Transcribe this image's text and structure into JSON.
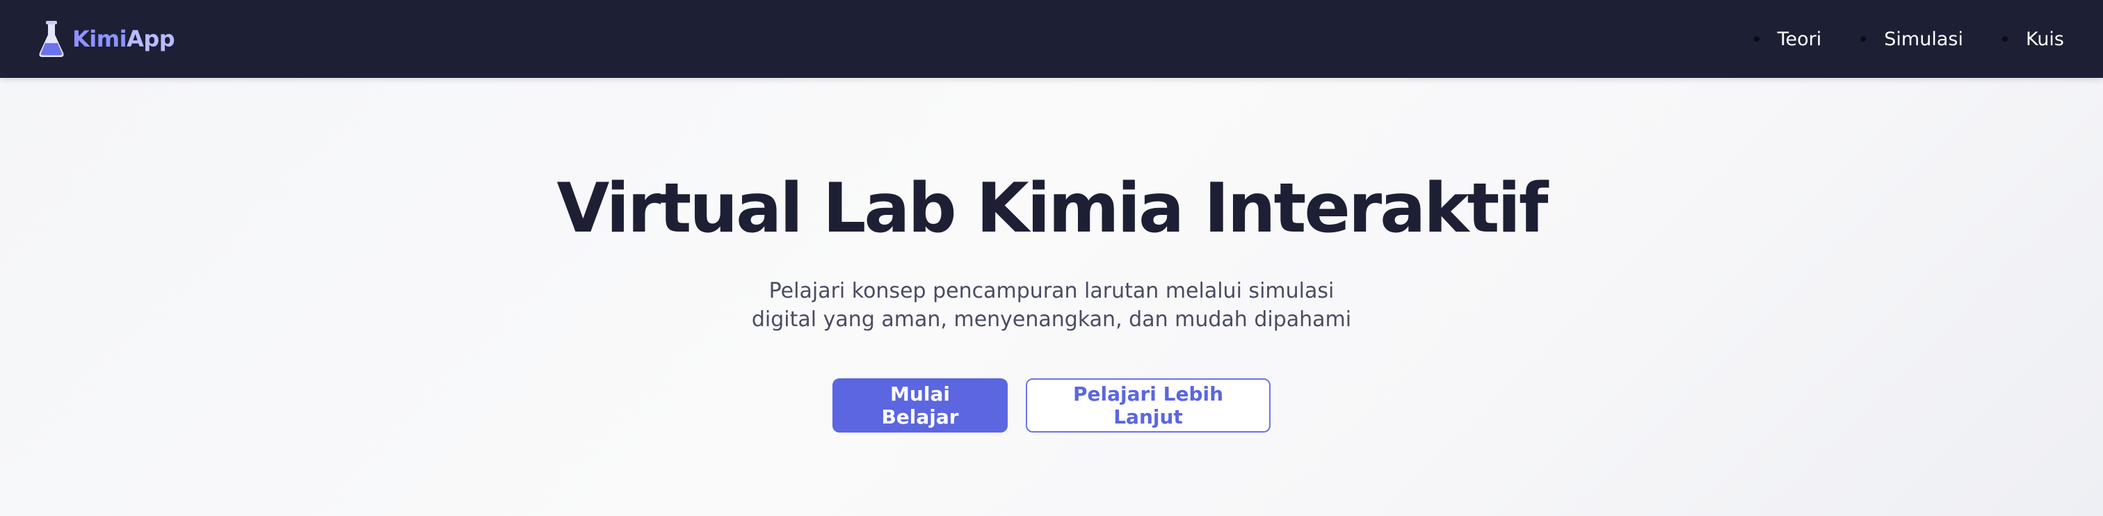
{
  "brand": {
    "name_part1": "Kimi",
    "name_part2": "App",
    "icon": "flask-icon"
  },
  "nav": {
    "items": [
      {
        "label": "Teori"
      },
      {
        "label": "Simulasi"
      },
      {
        "label": "Kuis"
      }
    ]
  },
  "hero": {
    "title": "Virtual Lab Kimia Interaktif",
    "subtitle_line1": "Pelajari konsep pencampuran larutan melalui simulasi",
    "subtitle_line2": "digital yang aman, menyenangkan, dan mudah dipahami",
    "primary_button": "Mulai Belajar",
    "secondary_button": "Pelajari Lebih Lanjut"
  },
  "colors": {
    "navbar": "#1d1f35",
    "accent": "#5b66e0",
    "title_text": "#1d1f35",
    "brand_kimi": "#8f93ff"
  }
}
